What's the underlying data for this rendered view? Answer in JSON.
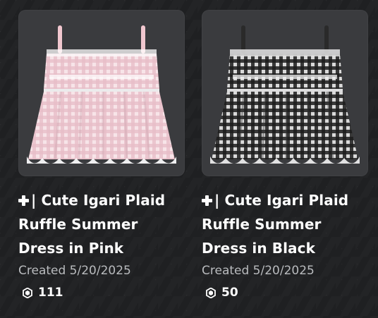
{
  "items": [
    {
      "title": "| Cute Igari Plaid Ruffle Summer Dress in Pink",
      "created": "Created 5/20/2025",
      "price": "111",
      "colors": {
        "dark": "#e6bcc6",
        "light": "#f7e4e8",
        "strap": "#f1c7cf",
        "frill": "#ffffff",
        "shade": "#cba3ad"
      }
    },
    {
      "title": "| Cute Igari Plaid Ruffle Summer Dress in Black",
      "created": "Created 5/20/2025",
      "price": "50",
      "colors": {
        "dark": "#1c1c1c",
        "light": "#d9d9d9",
        "strap": "#2a2a2a",
        "frill": "#f0f0f0",
        "shade": "#3a3a3a"
      }
    }
  ],
  "icons": {
    "plus": "plus-icon",
    "currency": "robux-icon"
  }
}
